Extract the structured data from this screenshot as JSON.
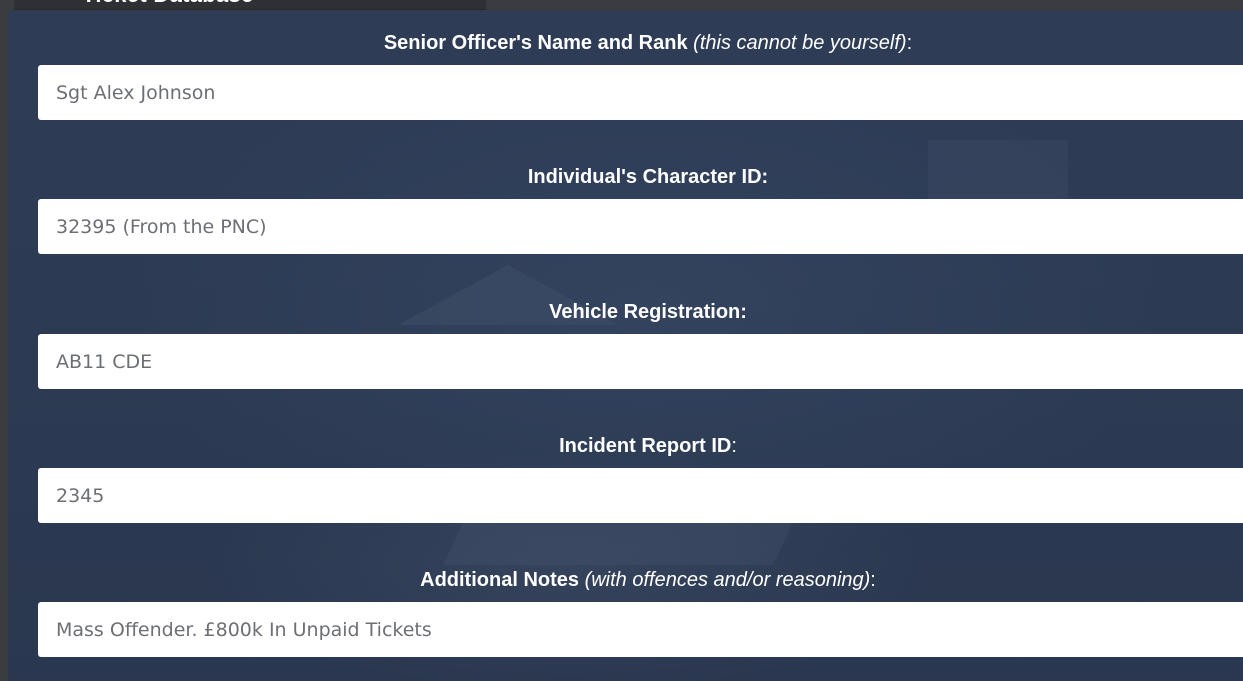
{
  "header": {
    "title": "Ticket Database"
  },
  "form": {
    "fields": [
      {
        "label_bold": "Senior Officer's Name and Rank",
        "label_italic": "(this cannot be yourself)",
        "label_suffix": ":",
        "placeholder": "Sgt Alex Johnson"
      },
      {
        "label_bold": "Individual's Character ID:",
        "label_italic": "",
        "label_suffix": "",
        "placeholder": "32395 (From the PNC)"
      },
      {
        "label_bold": "Vehicle Registration:",
        "label_italic": "",
        "label_suffix": "",
        "placeholder": "AB11 CDE"
      },
      {
        "label_bold": "Incident Report ID",
        "label_italic": "",
        "label_suffix": ":",
        "placeholder": "2345"
      },
      {
        "label_bold": "Additional Notes",
        "label_italic": "(with offences and/or reasoning)",
        "label_suffix": ":",
        "placeholder": "Mass Offender. £800k In Unpaid Tickets"
      }
    ]
  },
  "colors": {
    "panel": "#2c3b55",
    "frame": "#3a3c3f",
    "input_bg": "#ffffff",
    "label_text": "#ffffff"
  }
}
